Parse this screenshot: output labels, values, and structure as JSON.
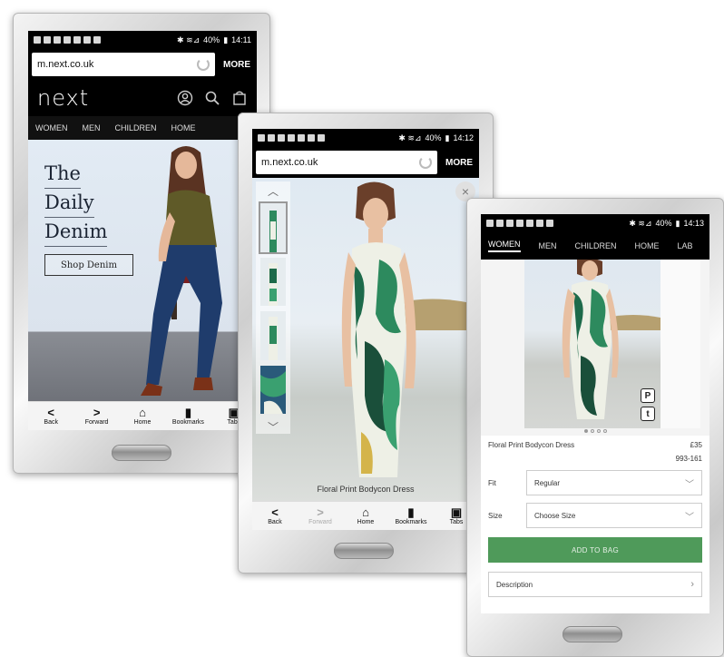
{
  "colors": {
    "accent_green": "#4f9a5a",
    "header_black": "#000000"
  },
  "phone1": {
    "status": {
      "battery": "40%",
      "time": "14:11"
    },
    "url": "m.next.co.uk",
    "more_label": "MORE",
    "logo": "next",
    "nav": [
      "WOMEN",
      "MEN",
      "CHILDREN",
      "HOME"
    ],
    "hero": {
      "line1": "The",
      "line2": "Daily",
      "line3": "Denim",
      "cta": "Shop Denim"
    },
    "toolbar": [
      {
        "icon": "<",
        "label": "Back"
      },
      {
        "icon": ">",
        "label": "Forward"
      },
      {
        "icon": "⌂",
        "label": "Home"
      },
      {
        "icon": "▮",
        "label": "Bookmarks"
      },
      {
        "icon": "▣",
        "label": "Tabs"
      }
    ]
  },
  "phone2": {
    "status": {
      "battery": "40%",
      "time": "14:12"
    },
    "url": "m.next.co.uk",
    "more_label": "MORE",
    "caption": "Floral Print Bodycon Dress",
    "close": "×",
    "toolbar": [
      {
        "icon": "<",
        "label": "Back"
      },
      {
        "icon": ">",
        "label": "Forward"
      },
      {
        "icon": "⌂",
        "label": "Home"
      },
      {
        "icon": "▮",
        "label": "Bookmarks"
      },
      {
        "icon": "▣",
        "label": "Tabs"
      }
    ]
  },
  "phone3": {
    "status": {
      "battery": "40%",
      "time": "14:13"
    },
    "nav": [
      "WOMEN",
      "MEN",
      "CHILDREN",
      "HOME",
      "LAB"
    ],
    "product": {
      "name": "Floral Print Bodycon Dress",
      "price": "£35",
      "code": "993-161"
    },
    "fit": {
      "label": "Fit",
      "value": "Regular"
    },
    "size": {
      "label": "Size",
      "value": "Choose Size"
    },
    "add_to_bag": "ADD TO BAG",
    "description": "Description",
    "share": {
      "pinterest": "P",
      "tumblr": "t"
    }
  }
}
